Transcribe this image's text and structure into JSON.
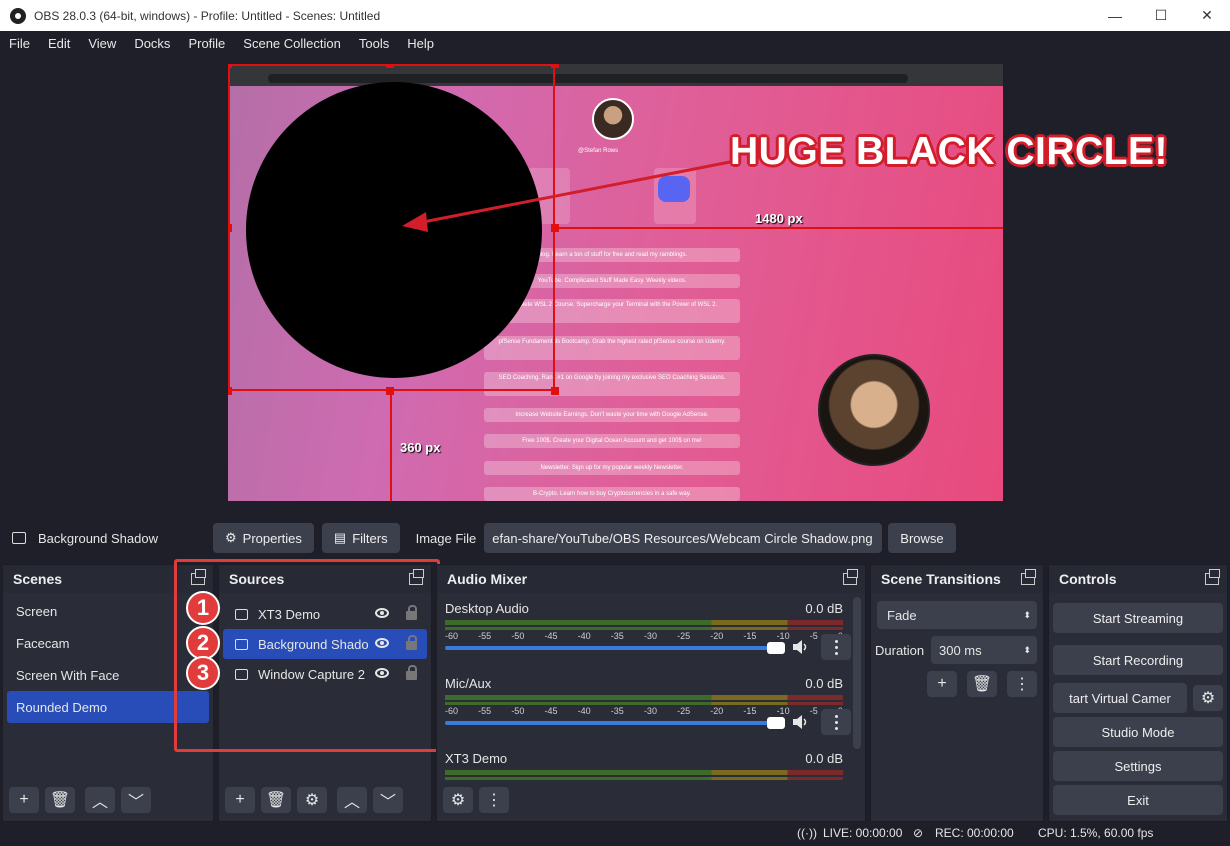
{
  "window": {
    "title": "OBS 28.0.3 (64-bit, windows) - Profile: Untitled - Scenes: Untitled",
    "minimize_glyph": "—",
    "maximize_glyph": "☐",
    "close_glyph": "✕"
  },
  "menu": [
    "File",
    "Edit",
    "View",
    "Docks",
    "Profile",
    "Scene Collection",
    "Tools",
    "Help"
  ],
  "preview": {
    "annotation_text": "HUGE BLACK CIRCLE!",
    "width_label": "1480 px",
    "height_label": "360 px",
    "handle_text": "@Stefan Rows",
    "links": [
      "Blog. Learn a ton of stuff for free and read my ramblings.",
      "YouTube. Complicated Stuff Made Easy. Weekly videos.",
      "Complete WSL 2 Course. Supercharge your Terminal with the Power of WSL 2.",
      "pfSense Fundamentals Bootcamp. Grab the highest rated pfSense course on Udemy.",
      "SEO Coaching. Rank #1 on Google by joining my exclusive SEO Coaching Sessions.",
      "Increase Website Earnings. Don't waste your time with Google AdSense.",
      "Free 100$. Create your Digital Ocean Account and get 100$ on me!",
      "Newsletter. Sign up for my popular weekly Newsletter.",
      "B-Crypto. Learn how to buy Cryptocurrencies in a safe way."
    ],
    "colors": {
      "accent_red": "#e01010",
      "selection_blue": "#284cb8"
    }
  },
  "source_toolbar": {
    "source_name": "Background Shadow",
    "properties_label": "Properties",
    "filters_label": "Filters",
    "image_file_label": "Image File",
    "image_file_value": "efan-share/YouTube/OBS Resources/Webcam Circle Shadow.png",
    "browse_label": "Browse"
  },
  "scenes": {
    "title": "Scenes",
    "items": [
      "Screen",
      "Facecam",
      "Screen With Face",
      "Rounded Demo"
    ],
    "selected_index": 3
  },
  "sources": {
    "title": "Sources",
    "items": [
      {
        "name": "XT3 Demo",
        "icon": "camera-icon",
        "badge": "1"
      },
      {
        "name": "Background Shadow",
        "icon": "image-icon",
        "badge": "2"
      },
      {
        "name": "Window Capture 2",
        "icon": "window-icon",
        "badge": "3"
      }
    ],
    "selected_index": 1
  },
  "audio_mixer": {
    "title": "Audio Mixer",
    "ticks": [
      "-60",
      "-55",
      "-50",
      "-45",
      "-40",
      "-35",
      "-30",
      "-25",
      "-20",
      "-15",
      "-10",
      "-5",
      "0"
    ],
    "channels": [
      {
        "name": "Desktop Audio",
        "db": "0.0 dB"
      },
      {
        "name": "Mic/Aux",
        "db": "0.0 dB"
      },
      {
        "name": "XT3 Demo",
        "db": "0.0 dB"
      }
    ]
  },
  "scene_transitions": {
    "title": "Scene Transitions",
    "transition": "Fade",
    "duration_label": "Duration",
    "duration_value": "300 ms"
  },
  "controls": {
    "title": "Controls",
    "start_streaming": "Start Streaming",
    "start_recording": "Start Recording",
    "virtual_camera": "tart Virtual Camer",
    "studio_mode": "Studio Mode",
    "settings": "Settings",
    "exit": "Exit"
  },
  "status": {
    "live": "LIVE: 00:00:00",
    "rec": "REC: 00:00:00",
    "cpu": "CPU: 1.5%, 60.00 fps"
  }
}
